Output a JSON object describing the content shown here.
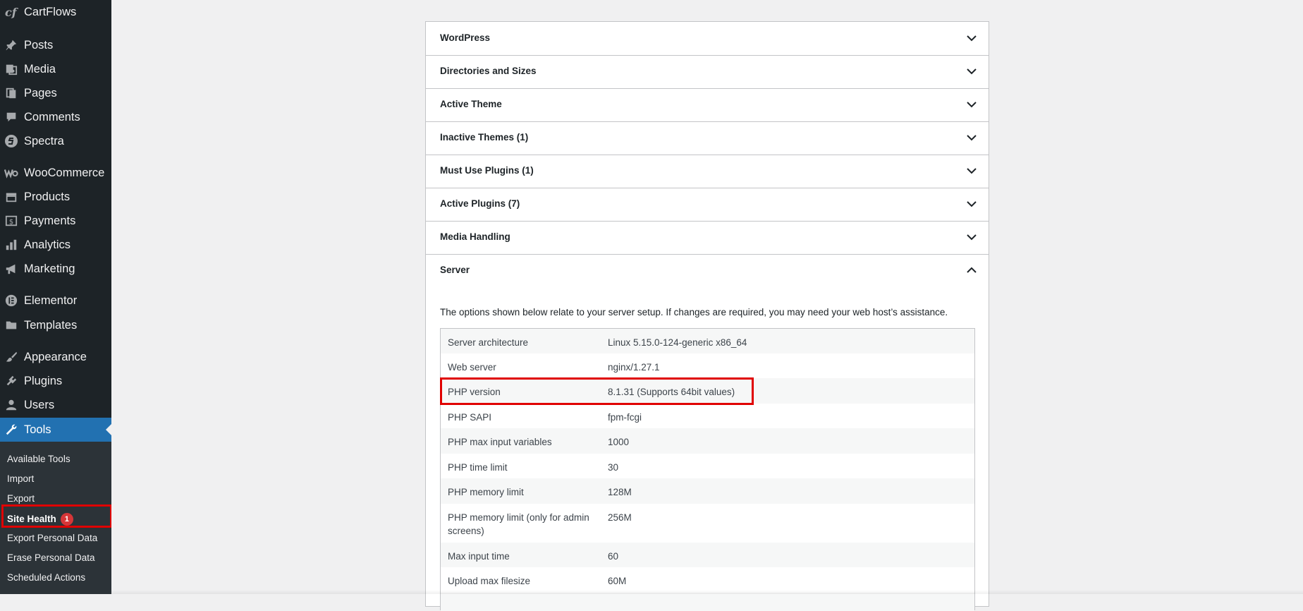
{
  "sidebar": {
    "items": [
      {
        "label": "CartFlows",
        "icon": "cartflows-icon"
      },
      {
        "label": "Posts",
        "icon": "pin-icon"
      },
      {
        "label": "Media",
        "icon": "media-icon"
      },
      {
        "label": "Pages",
        "icon": "pages-icon"
      },
      {
        "label": "Comments",
        "icon": "comment-icon"
      },
      {
        "label": "Spectra",
        "icon": "spectra-icon"
      },
      {
        "label": "WooCommerce",
        "icon": "woocommerce-icon"
      },
      {
        "label": "Products",
        "icon": "archive-icon"
      },
      {
        "label": "Payments",
        "icon": "payments-icon"
      },
      {
        "label": "Analytics",
        "icon": "bar-chart-icon"
      },
      {
        "label": "Marketing",
        "icon": "megaphone-icon"
      },
      {
        "label": "Elementor",
        "icon": "elementor-icon"
      },
      {
        "label": "Templates",
        "icon": "folder-icon"
      },
      {
        "label": "Appearance",
        "icon": "brush-icon"
      },
      {
        "label": "Plugins",
        "icon": "plug-icon"
      },
      {
        "label": "Users",
        "icon": "user-icon"
      },
      {
        "label": "Tools",
        "icon": "wrench-icon"
      }
    ],
    "submenu": [
      {
        "label": "Available Tools"
      },
      {
        "label": "Import"
      },
      {
        "label": "Export"
      },
      {
        "label": "Site Health",
        "badge": "1"
      },
      {
        "label": "Export Personal Data"
      },
      {
        "label": "Erase Personal Data"
      },
      {
        "label": "Scheduled Actions"
      }
    ]
  },
  "accordion": {
    "sections": [
      {
        "title": "WordPress"
      },
      {
        "title": "Directories and Sizes"
      },
      {
        "title": "Active Theme"
      },
      {
        "title": "Inactive Themes (1)"
      },
      {
        "title": "Must Use Plugins (1)"
      },
      {
        "title": "Active Plugins (7)"
      },
      {
        "title": "Media Handling"
      },
      {
        "title": "Server"
      }
    ],
    "server": {
      "description": "The options shown below relate to your server setup. If changes are required, you may need your web host’s assistance.",
      "rows": [
        {
          "key": "Server architecture",
          "value": "Linux 5.15.0-124-generic x86_64"
        },
        {
          "key": "Web server",
          "value": "nginx/1.27.1"
        },
        {
          "key": "PHP version",
          "value": "8.1.31 (Supports 64bit values)"
        },
        {
          "key": "PHP SAPI",
          "value": "fpm-fcgi"
        },
        {
          "key": "PHP max input variables",
          "value": "1000"
        },
        {
          "key": "PHP time limit",
          "value": "30"
        },
        {
          "key": "PHP memory limit",
          "value": "128M"
        },
        {
          "key": "PHP memory limit (only for admin screens)",
          "value": "256M"
        },
        {
          "key": "Max input time",
          "value": "60"
        },
        {
          "key": "Upload max filesize",
          "value": "60M"
        }
      ]
    }
  },
  "colors": {
    "sidebar_bg": "#1d2327",
    "active_blue": "#2271b1",
    "highlight_red": "#e00000",
    "badge_red": "#d63638"
  }
}
